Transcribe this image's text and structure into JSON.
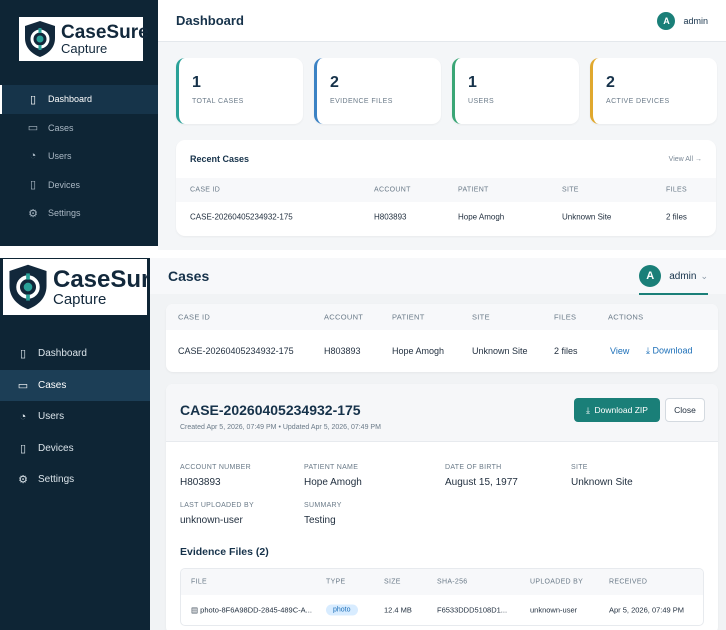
{
  "brand": {
    "name": "CaseSure",
    "tagline": "Capture"
  },
  "colors": {
    "sidebar": "#0e2535",
    "accent": "#1a7f78",
    "link": "#1c6fb8"
  },
  "nav": [
    {
      "label": "Dashboard",
      "icon": "bar-chart-icon"
    },
    {
      "label": "Cases",
      "icon": "folder-icon"
    },
    {
      "label": "Users",
      "icon": "users-icon"
    },
    {
      "label": "Devices",
      "icon": "phone-icon"
    },
    {
      "label": "Settings",
      "icon": "gear-icon"
    }
  ],
  "user": {
    "avatar_letter": "A",
    "name": "admin"
  },
  "dashboard": {
    "title": "Dashboard",
    "stats": [
      {
        "value": "1",
        "label": "TOTAL CASES",
        "color": "#2aa198"
      },
      {
        "value": "2",
        "label": "EVIDENCE FILES",
        "color": "#3b82c4"
      },
      {
        "value": "1",
        "label": "USERS",
        "color": "#3aa676"
      },
      {
        "value": "2",
        "label": "ACTIVE DEVICES",
        "color": "#e0a82e"
      }
    ],
    "recent": {
      "title": "Recent Cases",
      "view_all": "View All →",
      "columns": [
        "CASE ID",
        "ACCOUNT",
        "PATIENT",
        "SITE",
        "FILES"
      ],
      "rows": [
        {
          "case_id": "CASE-20260405234932-175",
          "account": "H803893",
          "patient": "Hope Amogh",
          "site": "Unknown Site",
          "files": "2 files"
        }
      ]
    }
  },
  "cases": {
    "title": "Cases",
    "columns": [
      "CASE ID",
      "ACCOUNT",
      "PATIENT",
      "SITE",
      "FILES",
      "ACTIONS"
    ],
    "rows": [
      {
        "case_id": "CASE-20260405234932-175",
        "account": "H803893",
        "patient": "Hope Amogh",
        "site": "Unknown Site",
        "files": "2 files",
        "view": "View",
        "download": "Download"
      }
    ],
    "detail": {
      "title": "CASE-20260405234932-175",
      "subtitle": "Created Apr 5, 2026, 07:49 PM • Updated Apr 5, 2026, 07:49 PM",
      "download_zip": "Download ZIP",
      "close": "Close",
      "account_label": "ACCOUNT NUMBER",
      "account_value": "H803893",
      "patient_label": "PATIENT NAME",
      "patient_value": "Hope Amogh",
      "dob_label": "DATE OF BIRTH",
      "dob_value": "August 15, 1977",
      "site_label": "SITE",
      "site_value": "Unknown Site",
      "uploader_label": "LAST UPLOADED BY",
      "uploader_value": "unknown-user",
      "summary_label": "SUMMARY",
      "summary_value": "Testing",
      "evidence_title": "Evidence Files (2)",
      "evidence_columns": [
        "FILE",
        "TYPE",
        "SIZE",
        "SHA-256",
        "UPLOADED BY",
        "RECEIVED"
      ],
      "evidence_rows": [
        {
          "file": "photo-8F6A98DD-2845-489C-A...",
          "type": "photo",
          "size": "12.4 MB",
          "sha": "F6533DDD5108D1...",
          "uploaded_by": "unknown-user",
          "received": "Apr 5, 2026, 07:49 PM"
        }
      ]
    }
  }
}
